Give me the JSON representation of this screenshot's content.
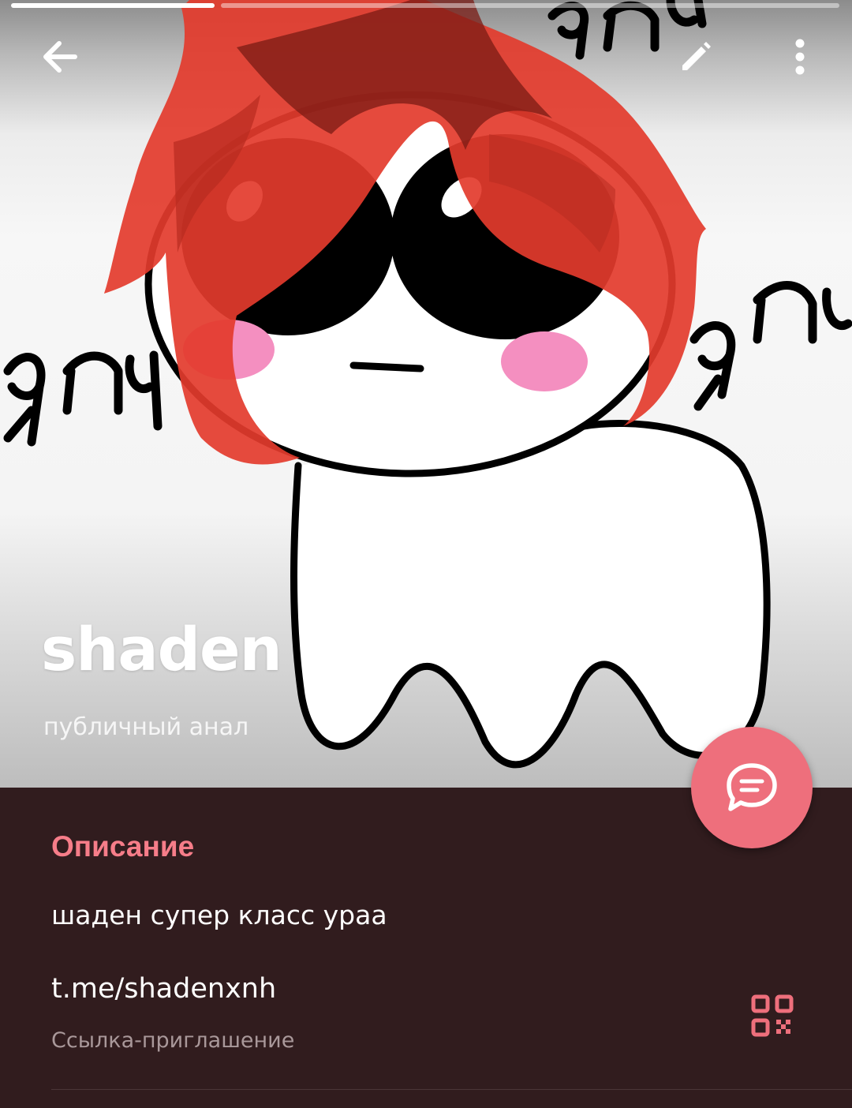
{
  "channel": {
    "title": "shaden",
    "subtitle": "публичный анал"
  },
  "info": {
    "section_header": "Описание",
    "description": "шаден супер класс ураа",
    "link": "t.me/shadenxnh",
    "link_caption": "Ссылка-приглашение"
  },
  "artwork_text": [
    "ЯПЧ",
    "ЯПЧ",
    "ЯПЧ"
  ],
  "icons": {
    "back": "arrow-left-icon",
    "edit": "pencil-icon",
    "more": "more-vertical-icon",
    "fab": "chat-bubble-icon",
    "qr": "qr-code-icon"
  },
  "colors": {
    "accent": "#ee6f7c",
    "section_header": "#f67d89",
    "background": "#311c1e",
    "secondary_text": "#a9989a"
  }
}
